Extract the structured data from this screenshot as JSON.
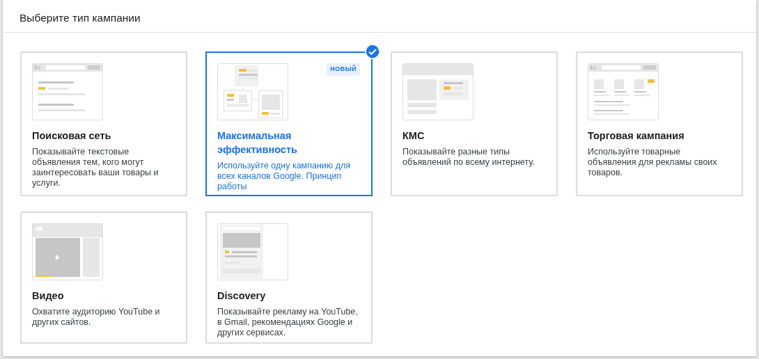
{
  "heading": "Выберите тип кампании",
  "campaigns": [
    {
      "kind": "search",
      "title": "Поисковая сеть",
      "description": "Показывайте текстовые объявления тем, кого могут заинтересовать ваши товары и услуги.",
      "selected": false
    },
    {
      "kind": "pmax",
      "title": "Максимальная эффективность",
      "description": "Используйте одну кампанию для всех каналов Google. Принцип работы",
      "badge": "НОВЫЙ",
      "selected": true
    },
    {
      "kind": "display",
      "title": "КМС",
      "description": "Показывайте разные типы объявлений по всему интернету.",
      "selected": false
    },
    {
      "kind": "shopping",
      "title": "Торговая кампания",
      "description": "Используйте товарные объявления для рекламы своих товаров.",
      "selected": false
    },
    {
      "kind": "video",
      "title": "Видео",
      "description": "Охватите аудиторию YouTube и других сайтов.",
      "selected": false
    },
    {
      "kind": "discovery",
      "title": "Discovery",
      "description": "Показывайте рекламу на YouTube, в Gmail, рекомендациях Google и других сервисах.",
      "selected": false
    }
  ]
}
